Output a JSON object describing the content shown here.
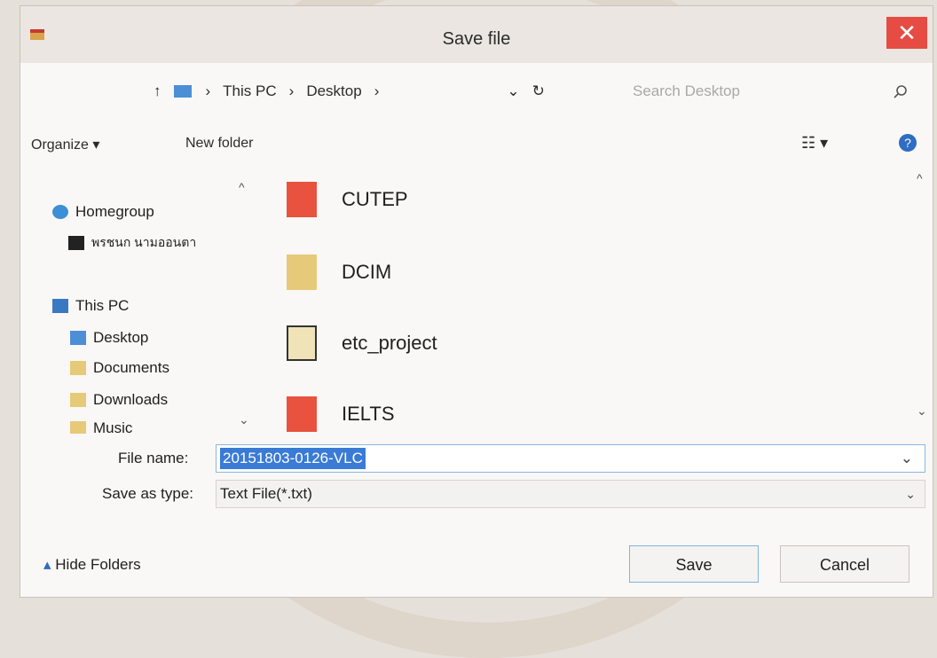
{
  "title": "Save file",
  "close_glyph": "✕",
  "address": {
    "up": "↑",
    "parts": [
      "This PC",
      "Desktop"
    ],
    "sep": "›",
    "refresh": "↻"
  },
  "search": {
    "placeholder": "Search Desktop",
    "icon": "search-icon"
  },
  "toolbar": {
    "organize": "Organize ▾",
    "new_folder": "New folder",
    "help": "?"
  },
  "nav": {
    "items": [
      "Homegroup",
      "พรชนก นามออนตา",
      "This PC",
      "Desktop",
      "Documents",
      "Downloads",
      "Music"
    ]
  },
  "files": [
    "CUTEP",
    "DCIM",
    "etc_project",
    "IELTS"
  ],
  "fields": {
    "file_name_label": "File name:",
    "file_name_value": "20151803-0126-VLC",
    "save_as_label": "Save as type:",
    "save_as_value": "Text File(*.txt)"
  },
  "hide_folders": "Hide Folders",
  "buttons": {
    "save": "Save",
    "cancel": "Cancel"
  },
  "colors": {
    "close": "#e64c43",
    "selection": "#3a7bd5",
    "accent": "#2f6cc2"
  }
}
